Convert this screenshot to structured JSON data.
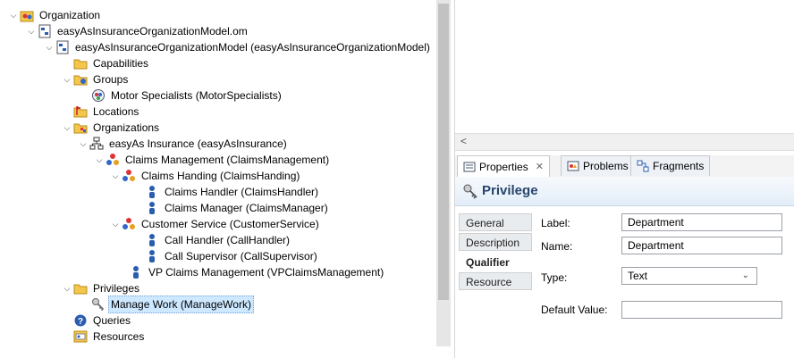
{
  "tree": {
    "items": [
      {
        "label": "Organization",
        "icon": "organization-root-icon"
      },
      {
        "label": "easyAsInsuranceOrganizationModel.om",
        "icon": "model-file-icon"
      },
      {
        "label": "easyAsInsuranceOrganizationModel (easyAsInsuranceOrganizationModel)",
        "icon": "model-icon"
      },
      {
        "label": "Capabilities",
        "icon": "folder-icon"
      },
      {
        "label": "Groups",
        "icon": "folder-icon"
      },
      {
        "label": "Motor Specialists (MotorSpecialists)",
        "icon": "group-icon"
      },
      {
        "label": "Locations",
        "icon": "folder-icon"
      },
      {
        "label": "Organizations",
        "icon": "folder-icon"
      },
      {
        "label": "easyAs Insurance (easyAsInsurance)",
        "icon": "organization-icon"
      },
      {
        "label": "Claims Management (ClaimsManagement)",
        "icon": "org-unit-icon"
      },
      {
        "label": "Claims Handing (ClaimsHanding)",
        "icon": "org-unit-icon"
      },
      {
        "label": "Claims Handler (ClaimsHandler)",
        "icon": "position-icon"
      },
      {
        "label": "Claims Manager (ClaimsManager)",
        "icon": "position-icon"
      },
      {
        "label": "Customer Service (CustomerService)",
        "icon": "org-unit-icon"
      },
      {
        "label": "Call Handler (CallHandler)",
        "icon": "position-icon"
      },
      {
        "label": "Call Supervisor (CallSupervisor)",
        "icon": "position-icon"
      },
      {
        "label": "VP Claims Management (VPClaimsManagement)",
        "icon": "position-icon"
      },
      {
        "label": "Privileges",
        "icon": "folder-icon"
      },
      {
        "label": "Manage Work (ManageWork)",
        "icon": "privilege-key-icon"
      },
      {
        "label": "Queries",
        "icon": "queries-icon"
      },
      {
        "label": "Resources",
        "icon": "resources-icon"
      }
    ]
  },
  "tabs": {
    "properties": "Properties",
    "problems": "Problems",
    "fragments": "Fragments",
    "close_glyph": "✕"
  },
  "hscroll": {
    "left_arrow": "<"
  },
  "panel": {
    "title": "Privilege"
  },
  "section_tabs": [
    "General",
    "Description",
    "Qualifier",
    "Resource"
  ],
  "form": {
    "label_label": "Label:",
    "label_value": "Department",
    "name_label": "Name:",
    "name_value": "Department",
    "type_label": "Type:",
    "type_value": "Text",
    "default_label": "Default Value:",
    "default_value": ""
  },
  "colors": {
    "selection": "#cde8ff",
    "title_text": "#27456b"
  }
}
